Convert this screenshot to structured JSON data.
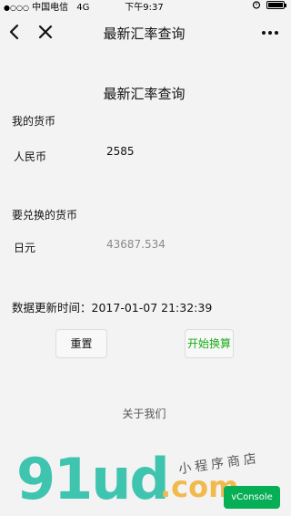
{
  "status_bar": {
    "signal": "●○○○",
    "carrier": "中国电信",
    "network": "4G",
    "time": "下午9:37"
  },
  "nav": {
    "title": "最新汇率查询"
  },
  "page": {
    "heading": "最新汇率查询",
    "my_currency_label": "我的货币",
    "my_currency_name": "人民币",
    "my_currency_amount": "2585",
    "target_currency_label": "要兑换的货币",
    "target_currency_name": "日元",
    "target_currency_amount": "43687.534",
    "update_label": "数据更新时间：",
    "update_time": "2017-01-07 21:32:39",
    "reset_button": "重置",
    "convert_button": "开始换算",
    "about": "关于我们"
  },
  "watermark": {
    "logo": "91ud",
    "com": ".com",
    "tagline": "小程序商店"
  },
  "vconsole": {
    "label": "vConsole"
  },
  "colors": {
    "convert_text": "#1aad19",
    "vconsole_bg": "#06ae56",
    "logo_teal": "#3fc4b0",
    "logo_orange": "#f2b94b"
  }
}
